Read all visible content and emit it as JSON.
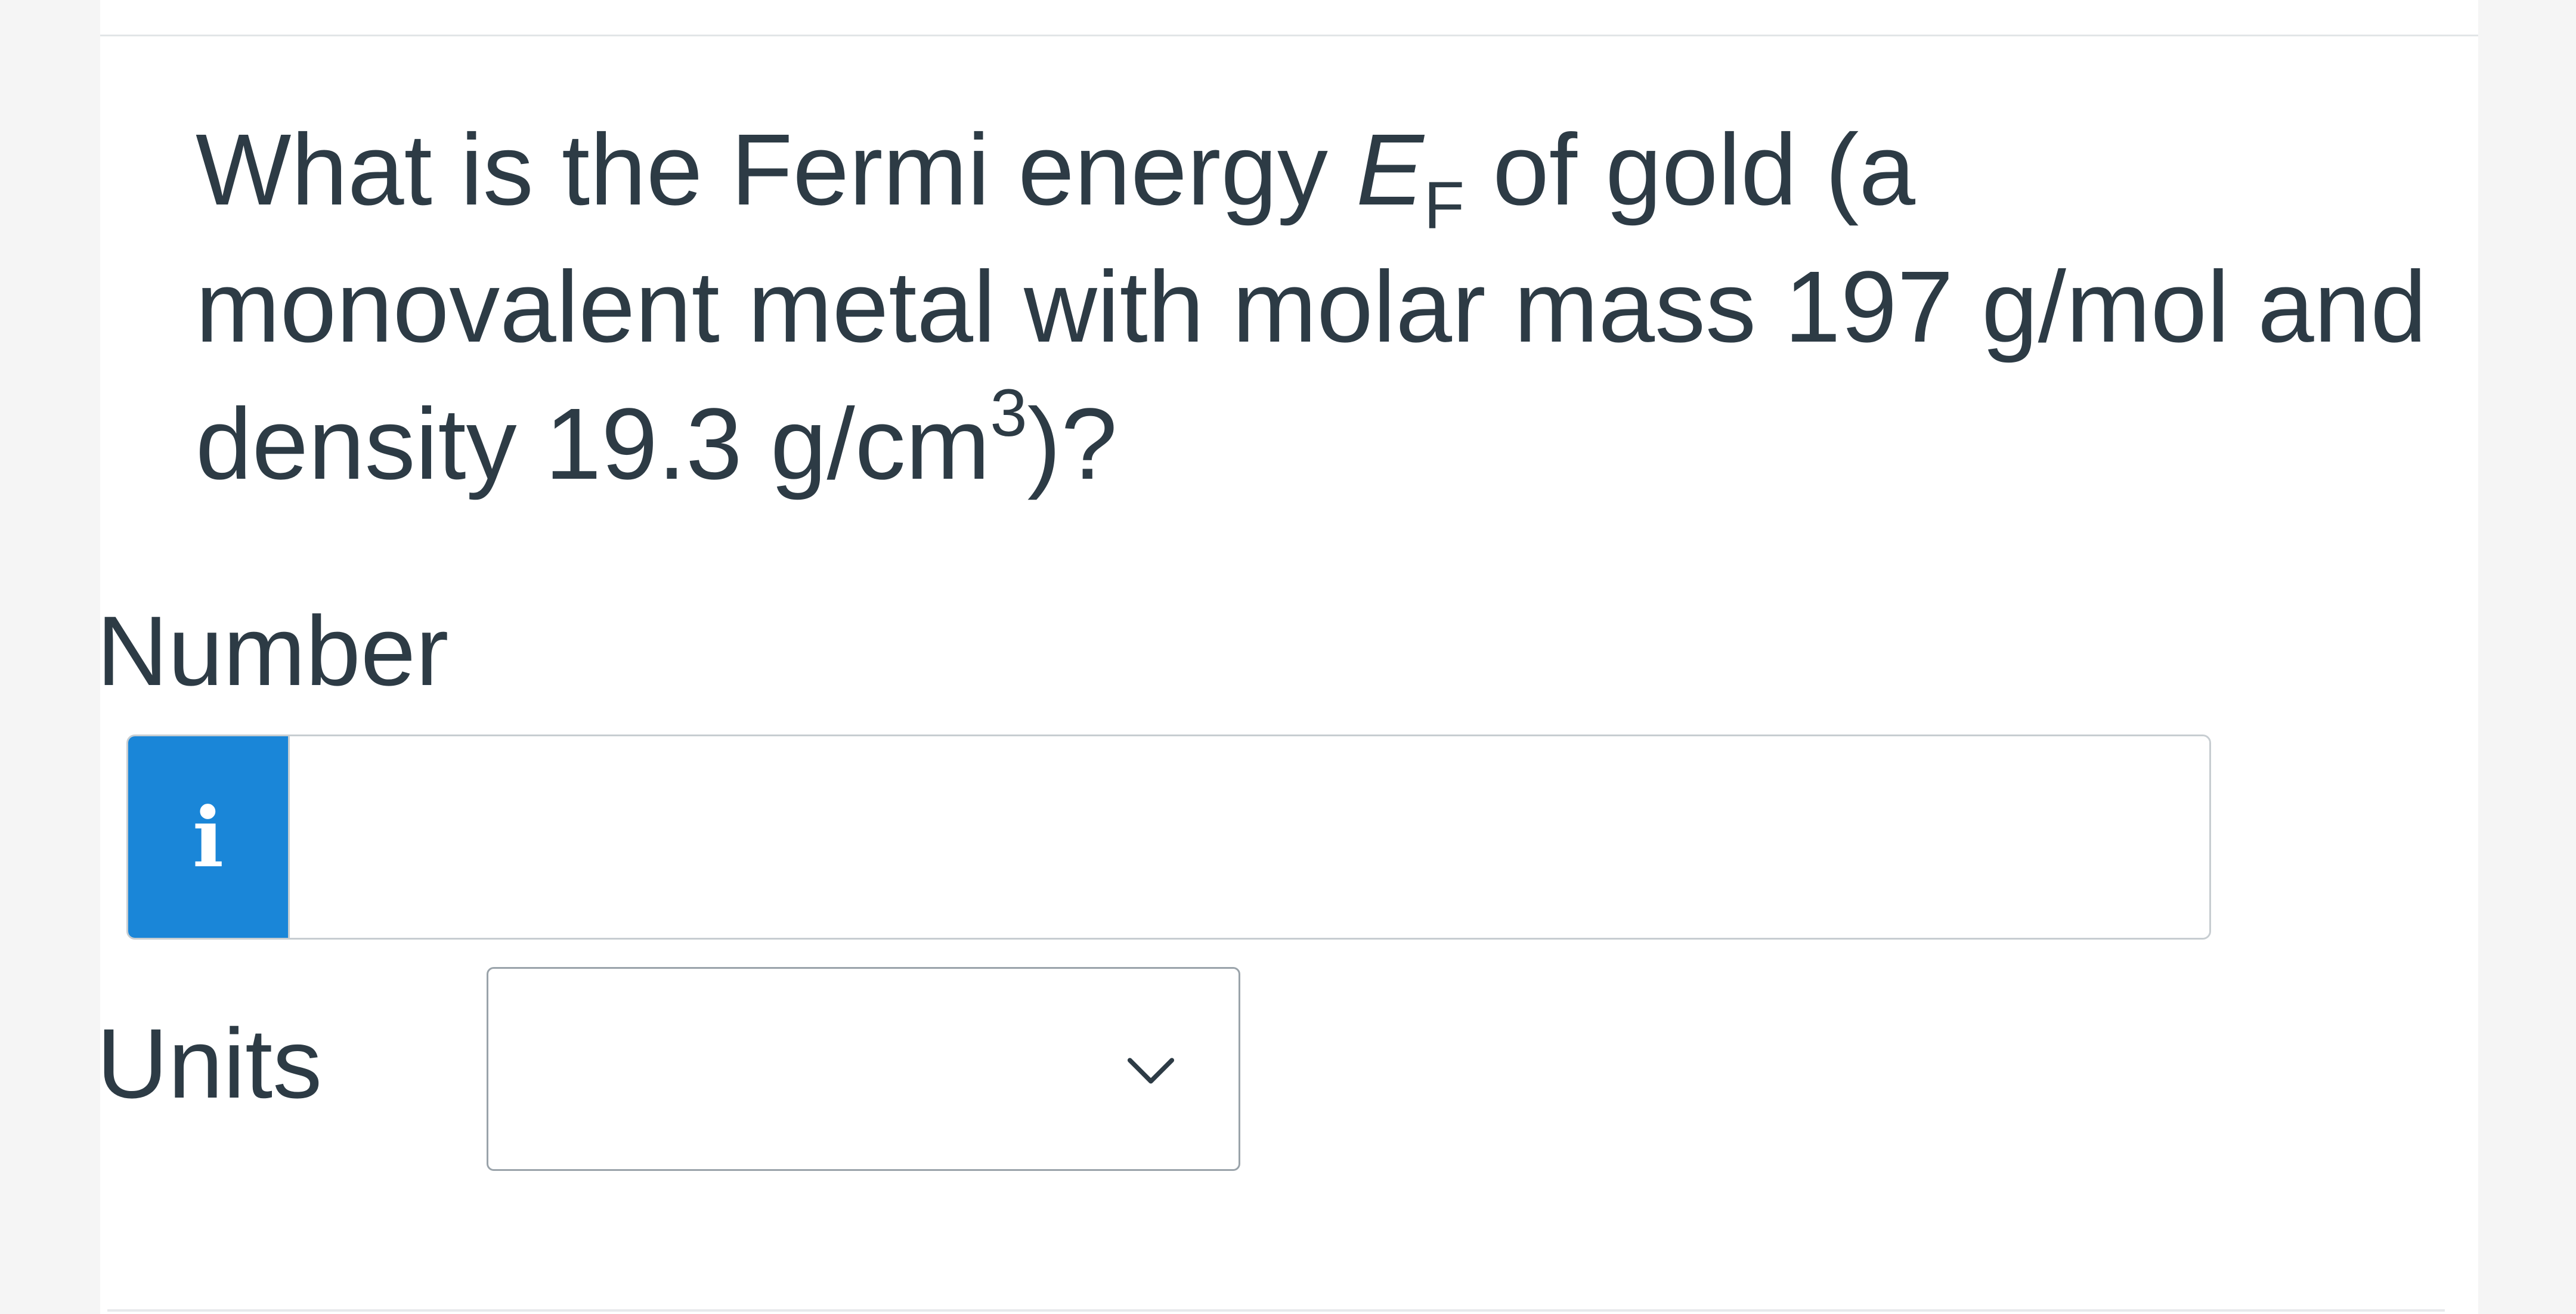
{
  "question": {
    "part1": "What is the Fermi energy ",
    "var": "E",
    "var_sub": "F",
    "part2": " of gold (a",
    "line2": "monovalent metal with molar mass 197 g/mol and",
    "line3_part1": "density 19.3 g/cm",
    "line3_sup": "3",
    "line3_part2": ")?"
  },
  "number_field": {
    "label": "Number",
    "info_icon": "info-icon",
    "info_glyph": "i",
    "value": "",
    "placeholder": ""
  },
  "units_field": {
    "label": "Units",
    "selected": "",
    "icon": "chevron-down-icon"
  },
  "colors": {
    "text": "#2d3b45",
    "info_button": "#1a86d8",
    "border": "#c7cdd1"
  }
}
